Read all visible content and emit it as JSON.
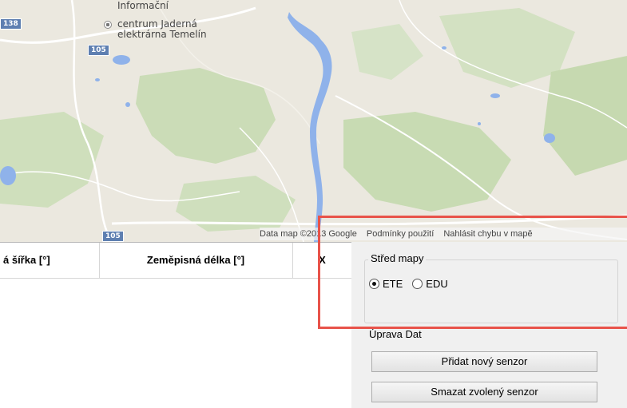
{
  "map": {
    "place_label": [
      "Informační",
      "centrum Jaderná",
      "elektrárna Temelín"
    ],
    "road_shields": [
      "138",
      "105",
      "105"
    ],
    "attribution": {
      "data": "Data map ©2013 Google",
      "terms": "Podmínky použití",
      "report": "Nahlásit chybu v mapě"
    }
  },
  "grid": {
    "columns": [
      "á šířka [°]",
      "Zeměpisná délka [°]",
      "X"
    ]
  },
  "panel": {
    "map_center": {
      "title": "Střed mapy",
      "options": [
        "ETE",
        "EDU"
      ],
      "selected": "ETE"
    },
    "data_edit": {
      "title": "Úprava Dat",
      "add_button": "Přidat nový senzor",
      "delete_button": "Smazat zvolený senzor"
    }
  },
  "colors": {
    "map_bg": "#e9e6dd",
    "forest": "#c9dcb5",
    "water": "#8fb1ea",
    "highlight": "#e8534a"
  }
}
